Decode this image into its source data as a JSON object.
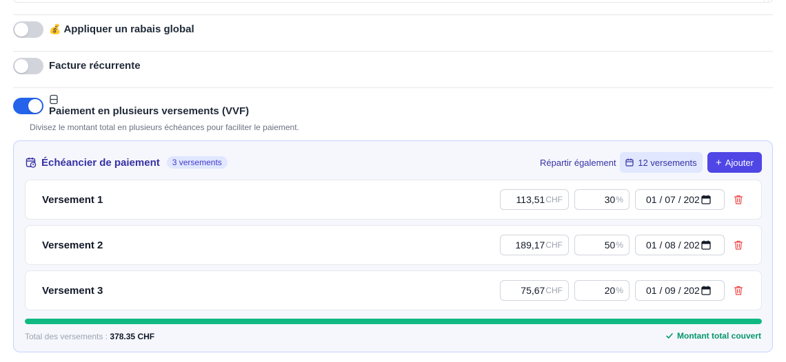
{
  "settings": {
    "global_discount": {
      "emoji": "💰",
      "label": "Appliquer un rabais global",
      "enabled": false
    },
    "recurring_invoice": {
      "label": "Facture récurrente",
      "enabled": false
    },
    "installments": {
      "label": "Paiement en plusieurs versements (VVF)",
      "hint": "Divisez le montant total en plusieurs échéances pour faciliter le paiement.",
      "enabled": true
    }
  },
  "schedule": {
    "title": "Échéancier de paiement",
    "count_badge": "3 versements",
    "split_equally_label": "Répartir également",
    "installments_button_label": "12 versements",
    "add_button_label": "Ajouter",
    "currency": "CHF",
    "percent_symbol": "%",
    "items": [
      {
        "name": "Versement 1",
        "amount": "113,51",
        "percent": "30",
        "date": "01 / 07 / 202"
      },
      {
        "name": "Versement 2",
        "amount": "189,17",
        "percent": "50",
        "date": "01 / 08 / 202"
      },
      {
        "name": "Versement 3",
        "amount": "75,67",
        "percent": "20",
        "date": "01 / 09 / 202"
      }
    ],
    "progress_percent": 100,
    "total_label": "Total des versements :",
    "total_value": "378.35 CHF",
    "covered_label": "Montant total couvert"
  },
  "colors": {
    "accent": "#4f46e5",
    "toggle_on": "#2563eb",
    "success": "#10b981",
    "danger": "#ef4444"
  },
  "icons": {
    "discount": "money-bag-emoji",
    "vvf": "split-rectangle-icon",
    "schedule": "calendar-clock-icon",
    "installments_button": "calendar-icon",
    "add_button": "plus-icon",
    "date_field": "calendar-icon",
    "delete": "trash-icon",
    "covered": "check-icon"
  }
}
